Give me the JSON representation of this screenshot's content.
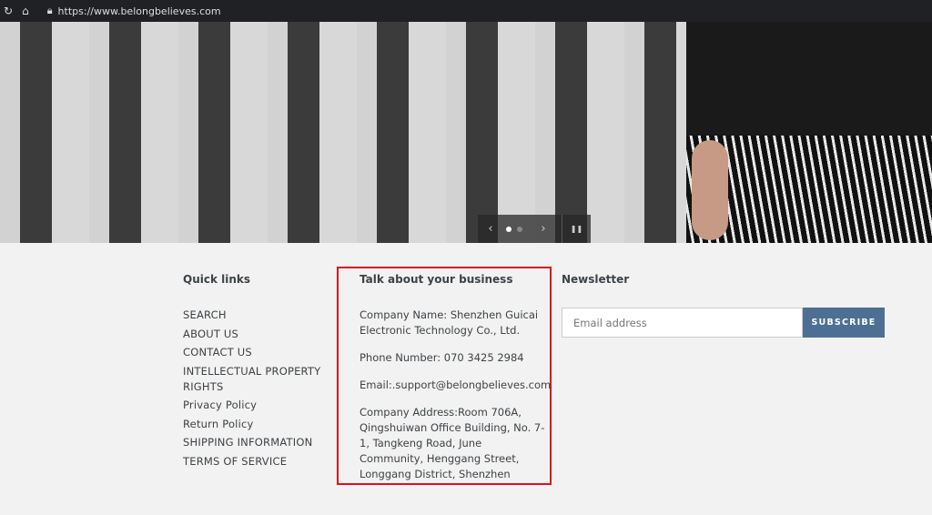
{
  "browser": {
    "url": "https://www.belongbelieves.com",
    "icons": [
      "reload-icon",
      "home-icon",
      "lock-icon"
    ]
  },
  "slideshow": {
    "prev": "‹",
    "next": "›",
    "pause": "❚❚",
    "slides": 2,
    "active": 1
  },
  "footer": {
    "quick_links": {
      "title": "Quick links",
      "items": [
        "SEARCH",
        "ABOUT US",
        "CONTACT US",
        "INTELLECTUAL PROPERTY RIGHTS",
        "Privacy Policy",
        "Return Policy",
        "SHIPPING INFORMATION",
        "TERMS OF SERVICE"
      ]
    },
    "business": {
      "title": "Talk about your business",
      "company_name": "Company Name: Shenzhen Guicai Electronic Technology Co., Ltd.",
      "phone": "Phone Number: 070 3425 2984",
      "email": "Email:.support@belongbelieves.com",
      "address": "Company Address:Room 706A, Qingshuiwan Office Building, No. 7-1, Tangkeng Road, June Community, Henggang Street, Longgang District, Shenzhen"
    },
    "newsletter": {
      "title": "Newsletter",
      "placeholder": "Email address",
      "button": "SUBSCRIBE"
    }
  },
  "colors": {
    "accent": "#4d6f94",
    "highlight_box": "#e0101a"
  }
}
